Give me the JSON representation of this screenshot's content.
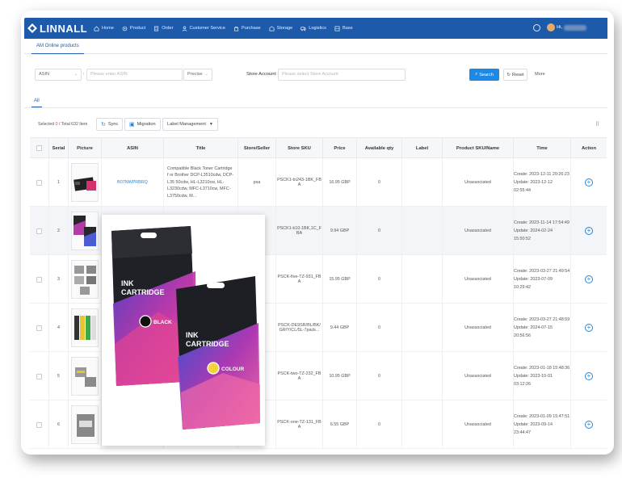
{
  "app": {
    "logo": "LINNALL",
    "nav": [
      {
        "label": "Home",
        "icon": "home-icon"
      },
      {
        "label": "Product",
        "icon": "product-icon"
      },
      {
        "label": "Order",
        "icon": "order-icon"
      },
      {
        "label": "Customer Service",
        "icon": "user-icon"
      },
      {
        "label": "Purchase",
        "icon": "purchase-icon"
      },
      {
        "label": "Storage",
        "icon": "storage-icon"
      },
      {
        "label": "Logistics",
        "icon": "logistics-icon"
      },
      {
        "label": "Base",
        "icon": "base-icon"
      }
    ],
    "user": "Hi,"
  },
  "page_tab": "AM Online products",
  "filter": {
    "field_select": "ASIN",
    "colon": ":",
    "asin_placeholder": "Please enter ASIN",
    "match_select": "Precise",
    "store_label": "Store Account:",
    "store_placeholder": "Please select Store Account",
    "search_label": "Search",
    "reset_label": "Reset",
    "more_label": "More"
  },
  "subtab": "All",
  "toolbar": {
    "selected_prefix": "Selected",
    "selected_count": "0",
    "total_text": "/ Total 632 Item",
    "sync_label": "Sync",
    "migration_label": "Migration",
    "label_mgmt": "Label Management"
  },
  "table": {
    "headers": [
      "Serial",
      "Picture",
      "ASIN",
      "Title",
      "Store/Seller",
      "Store SKU",
      "Price",
      "Available qty",
      "Label",
      "Product SKU/Name",
      "Time",
      "Action"
    ],
    "rows": [
      {
        "serial": "1",
        "asin": "B07NWPRBRQ",
        "title": "Compatible Black Toner Cartridge f or Brother DCP-L3510cdw, DCP-L35 50cdw, HL-L3210cw, HL-L3230cdw, MFC-L3710cw, MFC-L3750cdw, M...",
        "store": "psa",
        "sku": "PSCK1-tn243-1BK_FB A",
        "price": "16.95 GBP",
        "qty": "0",
        "label": "",
        "product": "Unassociated",
        "create": "Create: 2023-12-11 20:26:23",
        "update": "Update: 2023-12-12 02:55:44"
      },
      {
        "serial": "2",
        "asin": "",
        "title": "",
        "store": "",
        "sku": "PSCK1-k10-1BK,1C_F BA",
        "price": "9.94 GBP",
        "qty": "0",
        "label": "",
        "product": "Unassociated",
        "create": "Create: 2023-11-14 17:54:49",
        "update": "Update: 2024-02-24 15:50:52"
      },
      {
        "serial": "3",
        "asin": "",
        "title": "",
        "store": "",
        "sku": "PSCK-five-TZ-931_FB A",
        "price": "15.95 GBP",
        "qty": "0",
        "label": "",
        "product": "Unassociated",
        "create": "Create: 2023-03-27 21:49:54",
        "update": "Update: 2023-07-09 10:29:42"
      },
      {
        "serial": "4",
        "asin": "",
        "title": "",
        "store": "",
        "sku": "PSCK-DE9SR/BL/BK/ GR/Y/CL/5L-7pack...",
        "price": "9.44 GBP",
        "qty": "0",
        "label": "",
        "product": "Unassociated",
        "create": "Create: 2023-03-27 21:48:59",
        "update": "Update: 2024-07-15 20:56:56"
      },
      {
        "serial": "5",
        "asin": "",
        "title": "",
        "store": "",
        "sku": "PSCK-two-TZ-232_FB A",
        "price": "10.95 GBP",
        "qty": "0",
        "label": "",
        "product": "Unassociated",
        "create": "Create: 2023-01-18 15:48:36",
        "update": "Update: 2023-10-01 03:12:26"
      },
      {
        "serial": "6",
        "asin": "",
        "title": "",
        "store": "",
        "sku": "PSCK-one-TZ-131_FB A",
        "price": "6.55 GBP",
        "qty": "0",
        "label": "",
        "product": "Unassociated",
        "create": "Create: 2023-01-09 15:47:51",
        "update": "Update: 2023-09-14 23:44:47"
      }
    ]
  },
  "popup": {
    "pack_black": {
      "line1": "INK",
      "line2": "CARTRIDGE",
      "color": "BLACK"
    },
    "pack_colour": {
      "line1": "INK",
      "line2": "CARTRIDGE",
      "color": "COLOUR"
    }
  },
  "colors": {
    "brand": "#1d5baa",
    "accent": "#1e88e5",
    "count_red": "#e53935"
  }
}
